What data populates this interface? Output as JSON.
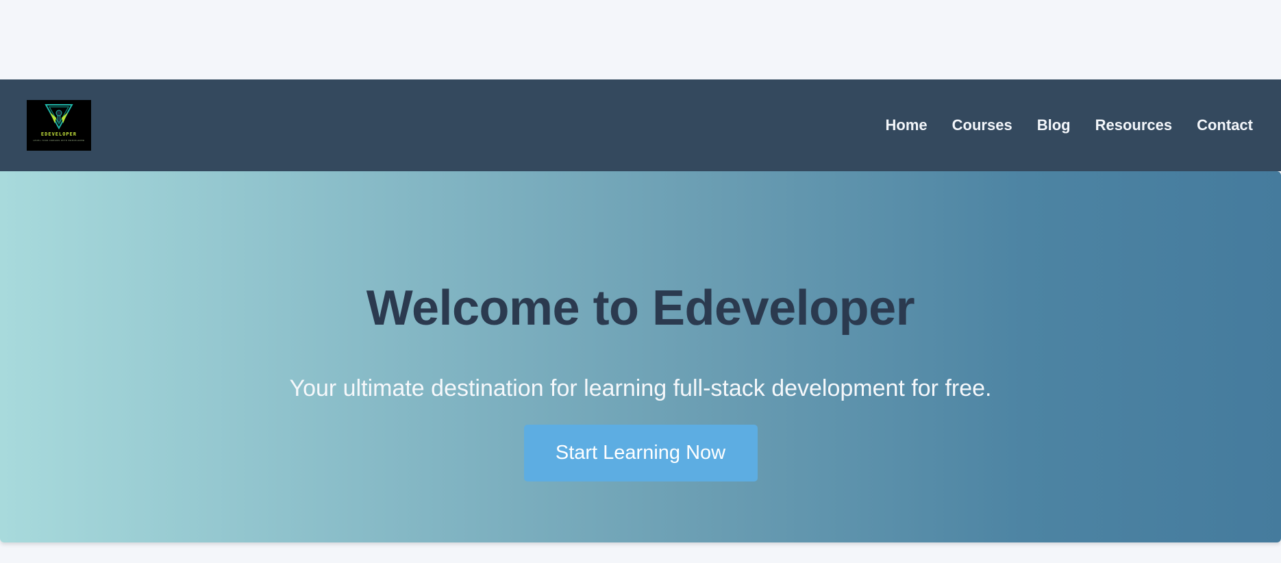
{
  "colors": {
    "page_background": "#f4f6fa",
    "navbar_background": "#34495e",
    "hero_gradient_start": "#a8dadc",
    "hero_gradient_end": "#457b9d",
    "title_color": "#2b3a4f",
    "button_background": "#5dade2",
    "logo_accent": "#c8e63c"
  },
  "header": {
    "logo": {
      "brand_text": "EDEVELOPER",
      "tagline": "LEVEL YOUR DREAMS WITH EDEVELOPER",
      "icon": "developer-emblem-icon"
    },
    "nav": [
      {
        "label": "Home"
      },
      {
        "label": "Courses"
      },
      {
        "label": "Blog"
      },
      {
        "label": "Resources"
      },
      {
        "label": "Contact"
      }
    ]
  },
  "hero": {
    "title": "Welcome to Edeveloper",
    "subtitle": "Your ultimate destination for learning full-stack development for free.",
    "cta_label": "Start Learning Now"
  }
}
